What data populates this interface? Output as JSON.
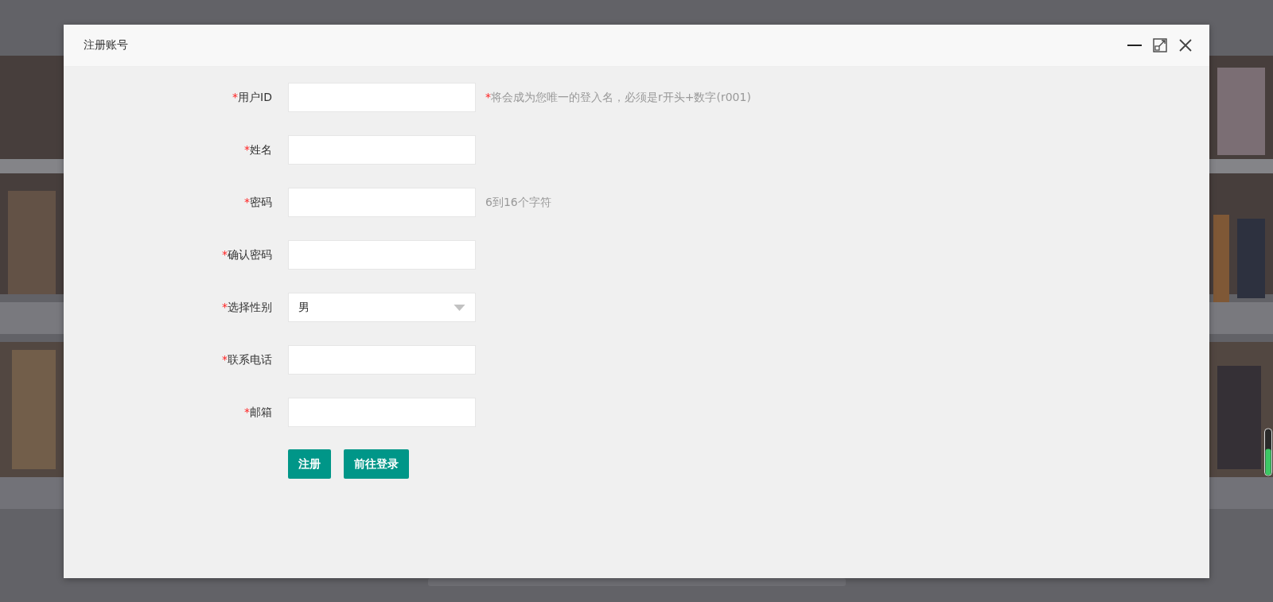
{
  "window": {
    "title": "注册账号",
    "controls": [
      {
        "kind": "minimize"
      },
      {
        "kind": "maximize"
      },
      {
        "kind": "close"
      }
    ]
  },
  "fields": [
    {
      "mark": "*",
      "label": "用户ID",
      "kind": "text",
      "hint": {
        "mark": "*",
        "text": "将会成为您唯一的登入名，必须是r开头+数字(r001)"
      }
    },
    {
      "mark": "*",
      "label": "姓名",
      "kind": "text"
    },
    {
      "mark": "*",
      "label": "密码",
      "kind": "password",
      "hint": {
        "text": "6到16个字符"
      }
    },
    {
      "mark": "*",
      "label": "确认密码",
      "kind": "password"
    },
    {
      "mark": "*",
      "label": "选择性别",
      "kind": "select",
      "value": "男"
    },
    {
      "mark": "*",
      "label": "联系电话",
      "kind": "text"
    },
    {
      "mark": "*",
      "label": "邮箱",
      "kind": "text"
    }
  ],
  "buttons": [
    "注册",
    "前往登录"
  ],
  "background": {
    "kind": "picture"
  }
}
